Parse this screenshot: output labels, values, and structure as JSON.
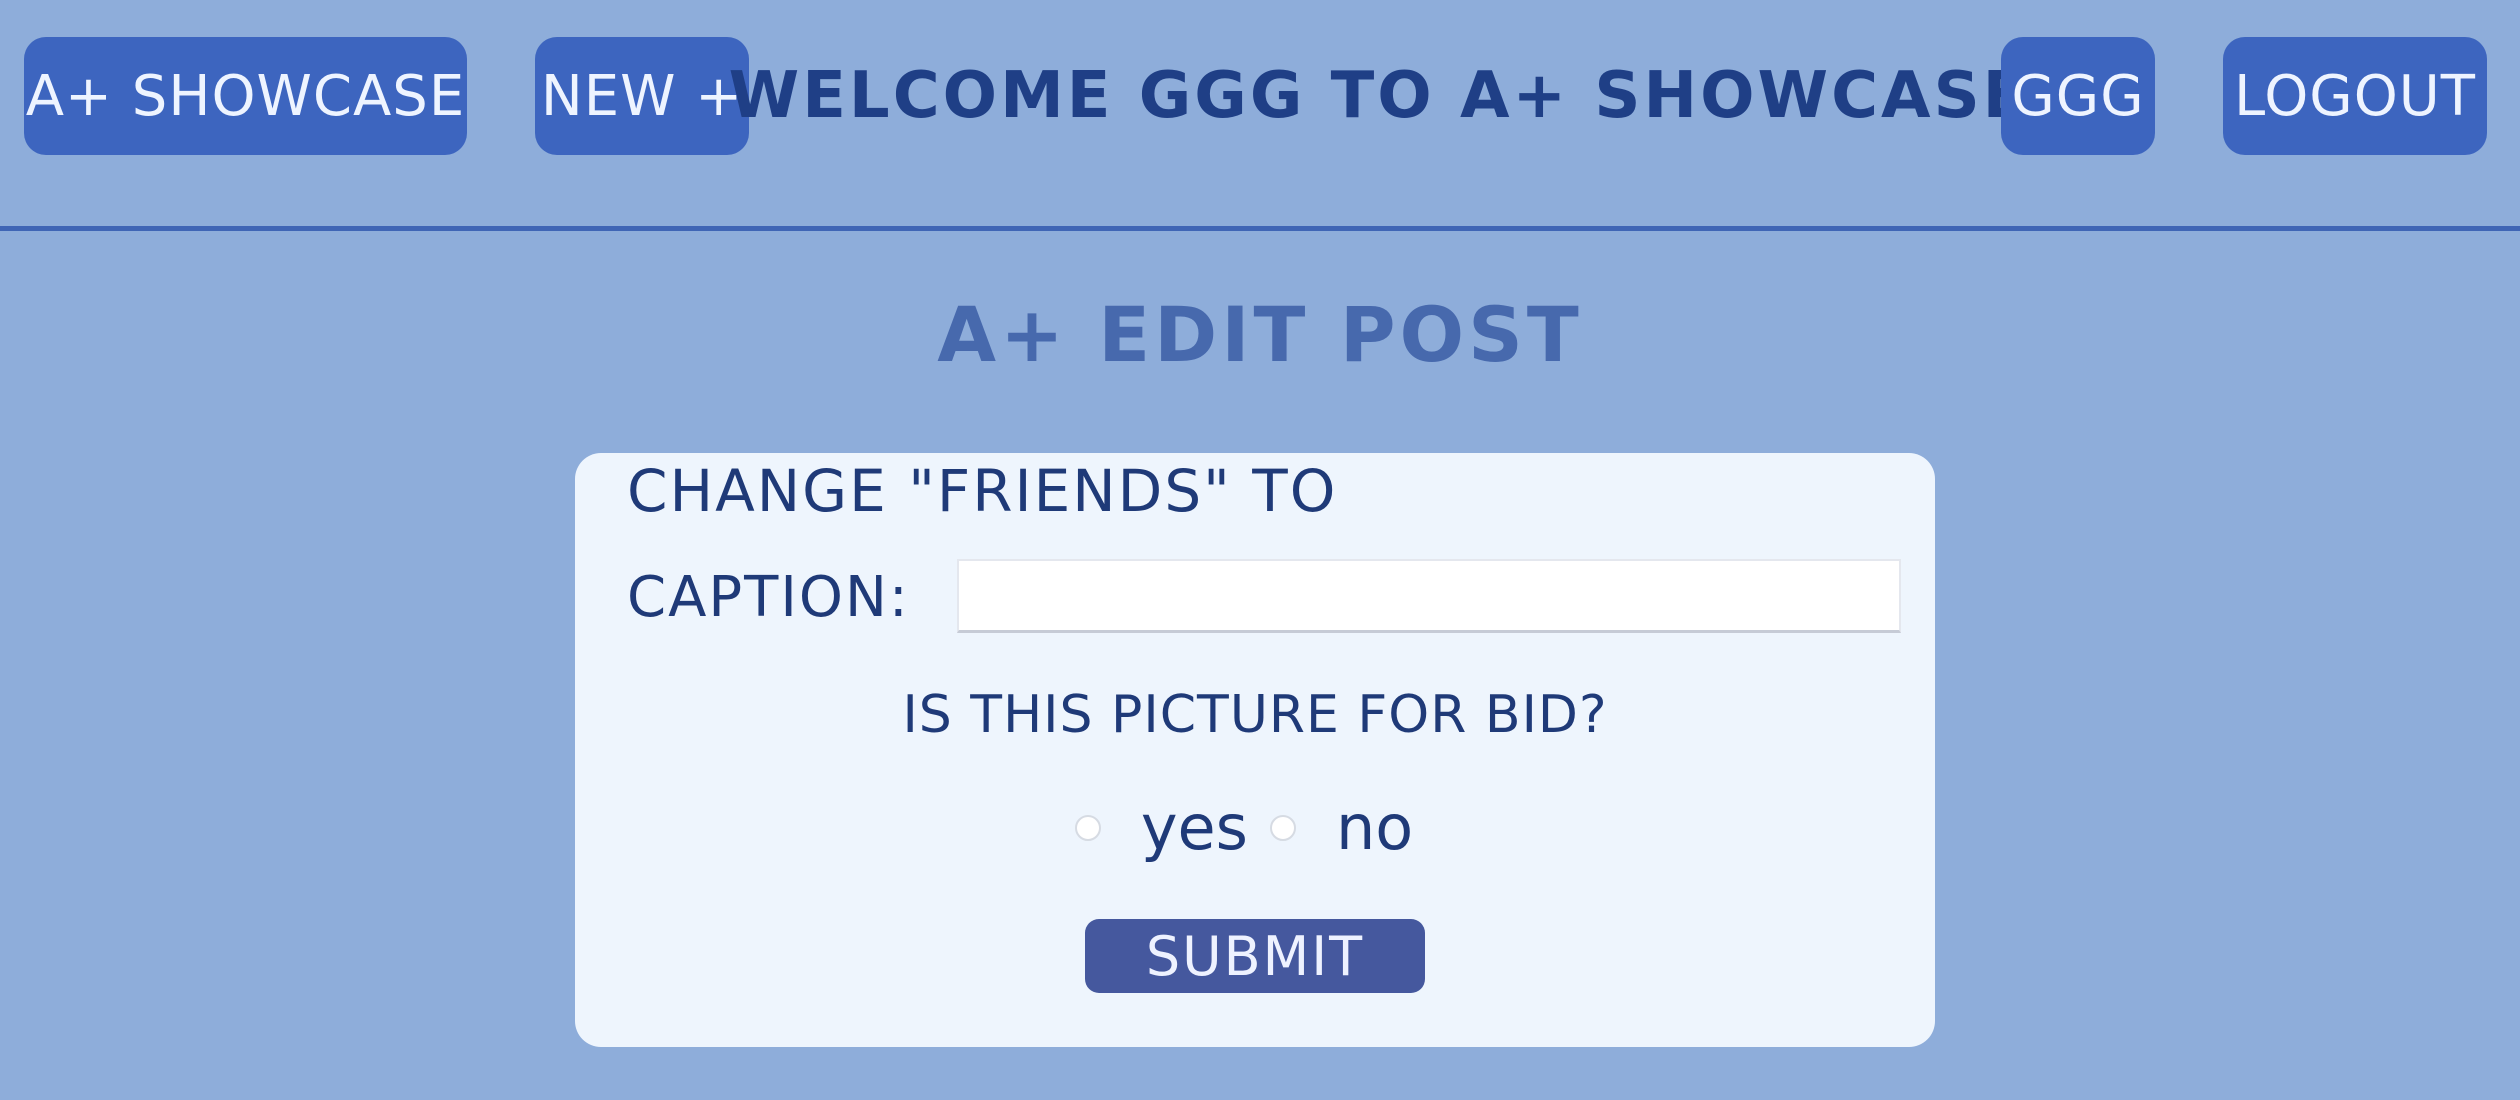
{
  "nav": {
    "home_label": "A+ SHOWCASE",
    "new_label": "NEW +",
    "welcome_text": "WELCOME GGG TO A+ SHOWCASE",
    "user_label": "GGG",
    "logout_label": "LOGOUT"
  },
  "page": {
    "title": "A+ EDIT POST"
  },
  "form": {
    "heading": "CHANGE \"FRIENDS\" TO",
    "caption_label": "CAPTION:",
    "caption_value": "",
    "caption_placeholder": "",
    "bid_question": "IS THIS PICTURE FOR BID?",
    "options": [
      {
        "label": "yes"
      },
      {
        "label": "no"
      }
    ],
    "submit_label": "SUBMIT"
  },
  "colors": {
    "background": "#8eadda",
    "nav_button": "#3d65bf",
    "submit_button": "#45589e",
    "card": "#eef5fd",
    "text_dark": "#1f3a78",
    "title": "#4769ad"
  }
}
